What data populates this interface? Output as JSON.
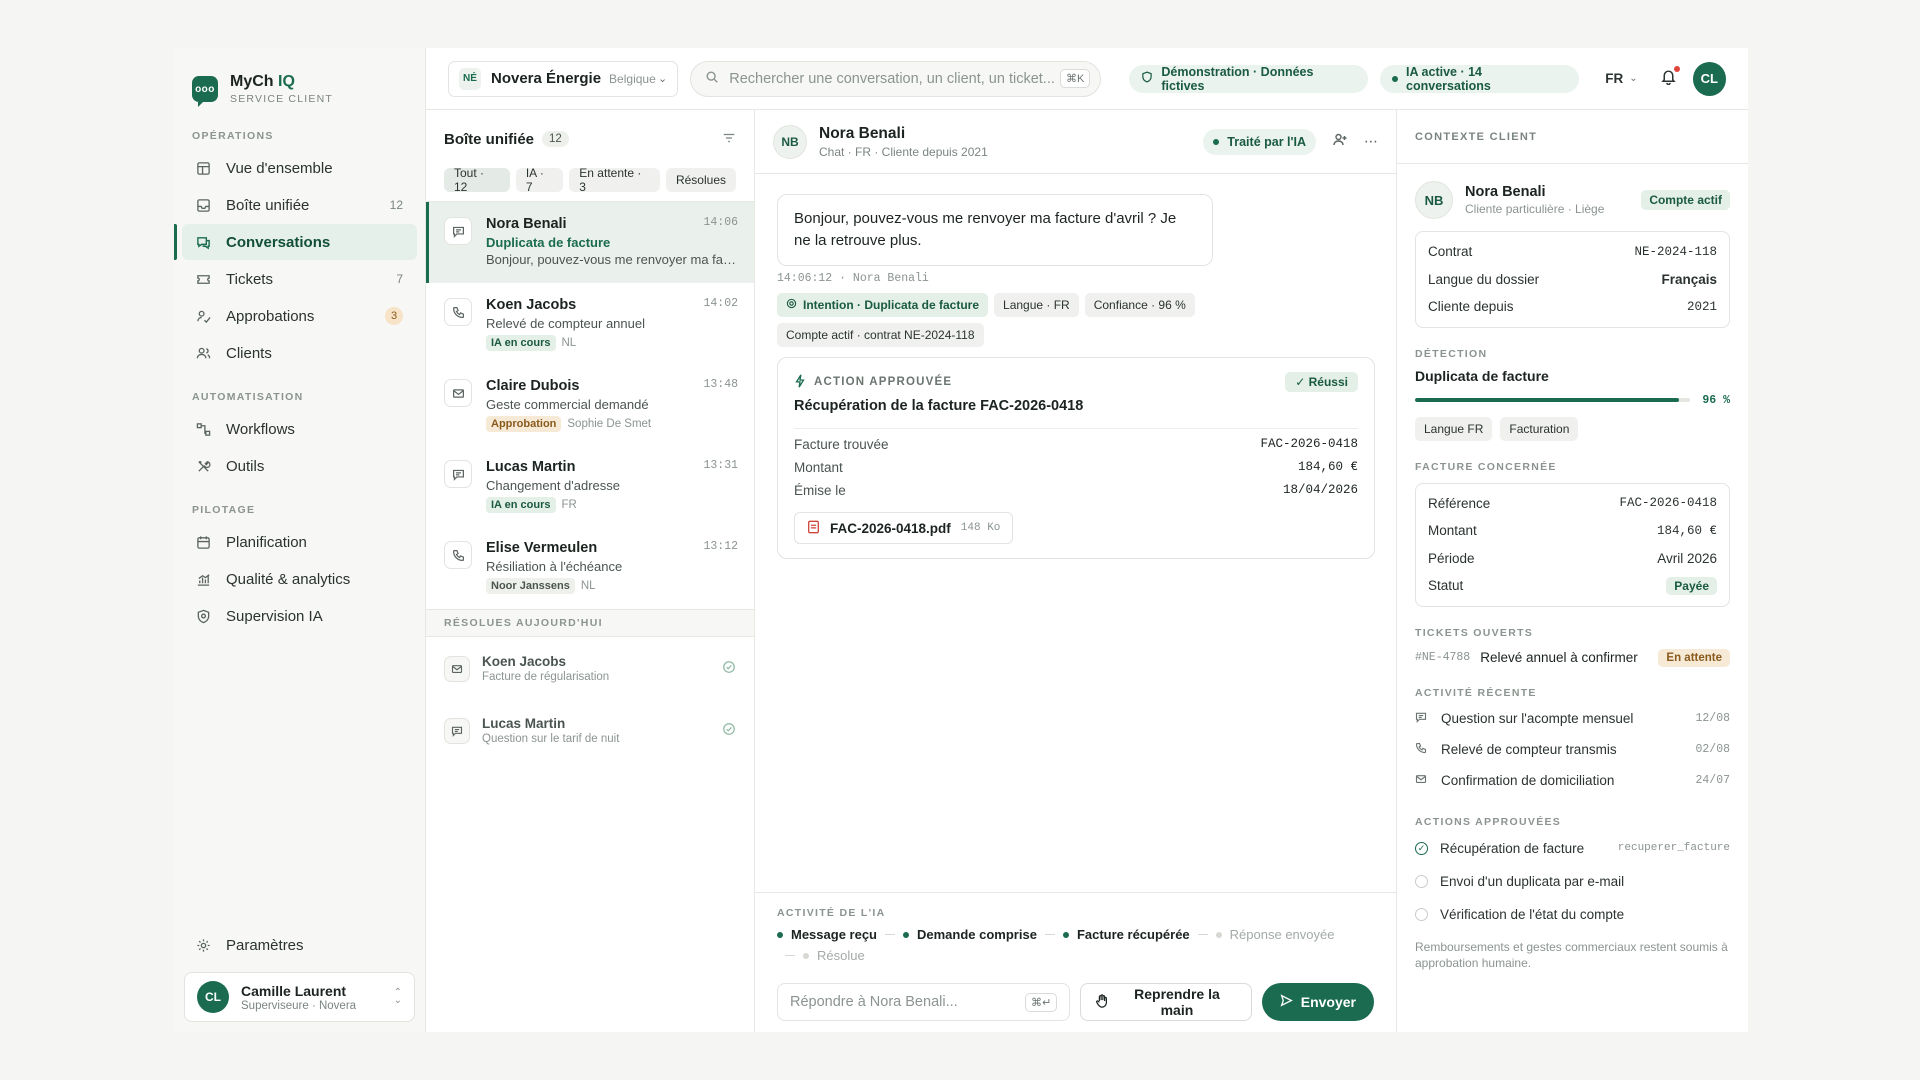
{
  "brand": {
    "name": "MyCh",
    "name_accent": "IQ",
    "subtitle": "SERVICE CLIENT",
    "logo_glyph": "ooo"
  },
  "sidebar": {
    "sections": [
      {
        "title": "OPÉRATIONS",
        "items": [
          {
            "label": "Vue d'ensemble",
            "icon": "layout-icon",
            "count": ""
          },
          {
            "label": "Boîte unifiée",
            "icon": "inbox-icon",
            "count": "12"
          },
          {
            "label": "Conversations",
            "icon": "chat-icon",
            "count": "",
            "active": true
          },
          {
            "label": "Tickets",
            "icon": "ticket-icon",
            "count": "7"
          },
          {
            "label": "Approbations",
            "icon": "signature-icon",
            "count": "3"
          },
          {
            "label": "Clients",
            "icon": "users-icon",
            "count": ""
          }
        ]
      },
      {
        "title": "AUTOMATISATION",
        "items": [
          {
            "label": "Workflows",
            "icon": "workflow-icon"
          },
          {
            "label": "Outils",
            "icon": "tools-icon"
          }
        ]
      },
      {
        "title": "PILOTAGE",
        "items": [
          {
            "label": "Planification",
            "icon": "calendar-icon"
          },
          {
            "label": "Qualité & analytics",
            "icon": "analytics-icon"
          },
          {
            "label": "Supervision IA",
            "icon": "shield-icon"
          }
        ]
      }
    ],
    "settings_label": "Paramètres",
    "user": {
      "initials": "CL",
      "name": "Camille Laurent",
      "role": "Superviseure · Novera"
    }
  },
  "topbar": {
    "org_badge": "NÉ",
    "org_name": "Novera Énergie",
    "org_country": "Belgique",
    "search_placeholder": "Rechercher une conversation, un client, un ticket...",
    "search_shortcut": "⌘K",
    "demo_pill": "Démonstration · Données fictives",
    "ai_pill": "IA active · 14 conversations",
    "lang": "FR",
    "user_initials": "CL"
  },
  "inbox": {
    "title": "Boîte unifiée",
    "count": "12",
    "filters": [
      "Tout · 12",
      "IA · 7",
      "En attente · 3",
      "Résolues"
    ],
    "conversations": [
      {
        "name": "Nora Benali",
        "time": "14:06",
        "subject": "Duplicata de facture",
        "preview": "Bonjour, pouvez-vous me renvoyer ma facture d'avril ? Je ne la retrouve plus.",
        "channel": "chat"
      },
      {
        "name": "Koen Jacobs",
        "time": "14:02",
        "subject": "Relevé de compteur annuel",
        "tag": "IA en cours",
        "meta": "NL",
        "channel": "phone"
      },
      {
        "name": "Claire Dubois",
        "time": "13:48",
        "subject": "Geste commercial demandé",
        "tag": "Approbation",
        "meta": "Sophie De Smet",
        "channel": "mail"
      },
      {
        "name": "Lucas Martin",
        "time": "13:31",
        "subject": "Changement d'adresse",
        "tag": "IA en cours",
        "meta": "FR",
        "channel": "chat"
      },
      {
        "name": "Elise Vermeulen",
        "time": "13:12",
        "subject": "Résiliation à l'échéance",
        "tag": "Noor Janssens",
        "meta": "NL",
        "channel": "phone"
      }
    ],
    "resolved_title": "RÉSOLUES AUJOURD'HUI",
    "resolved": [
      {
        "name": "Koen Jacobs",
        "subject": "Facture de régularisation"
      },
      {
        "name": "Lucas Martin",
        "subject": "Question sur le tarif de nuit"
      }
    ]
  },
  "conversation": {
    "initials": "NB",
    "name": "Nora Benali",
    "meta": "Chat · FR · Cliente depuis 2021",
    "ai_badge": "Traité par l'IA",
    "message": "Bonjour, pouvez-vous me renvoyer ma facture d'avril ? Je ne la retrouve plus.",
    "message_meta": "14:06:12 · Nora Benali",
    "chips": [
      "Intention · Duplicata de facture",
      "Langue · FR",
      "Confiance · 96 %",
      "Compte actif · contrat NE-2024-118"
    ],
    "action": {
      "label": "ACTION APPROUVÉE",
      "status": "Réussi",
      "title": "Récupération de la facture FAC-2026-0418",
      "rows": [
        {
          "k": "Facture trouvée",
          "v": "FAC-2026-0418"
        },
        {
          "k": "Montant",
          "v": "184,60 €"
        },
        {
          "k": "Émise le",
          "v": "18/04/2026"
        }
      ],
      "file_name": "FAC-2026-0418.pdf",
      "file_size": "148 Ko"
    },
    "activity_label": "ACTIVITÉ DE L'IA",
    "steps": [
      {
        "label": "Message reçu",
        "done": true
      },
      {
        "label": "Demande comprise",
        "done": true
      },
      {
        "label": "Facture récupérée",
        "done": true
      },
      {
        "label": "Réponse envoyée",
        "done": false
      },
      {
        "label": "Résolue",
        "done": false
      }
    ],
    "reply_placeholder": "Répondre à Nora Benali...",
    "reply_shortcut": "⌘↵",
    "takeover_label": "Reprendre la main",
    "send_label": "Envoyer"
  },
  "context": {
    "title": "CONTEXTE CLIENT",
    "client_initials": "NB",
    "client_name": "Nora Benali",
    "client_sub": "Cliente particulière · Liège",
    "account_badge": "Compte actif",
    "info": [
      {
        "k": "Contrat",
        "v": "NE-2024-118"
      },
      {
        "k": "Langue du dossier",
        "v": "Français"
      },
      {
        "k": "Cliente depuis",
        "v": "2021"
      }
    ],
    "detection_title": "DÉTECTION",
    "detection_value": "Duplicata de facture",
    "detection_confidence": 0.96,
    "detection_pct": "96 %",
    "detection_tags": [
      "Langue FR",
      "Facturation"
    ],
    "invoice_title": "FACTURE CONCERNÉE",
    "invoice": [
      {
        "k": "Référence",
        "v": "FAC-2026-0418"
      },
      {
        "k": "Montant",
        "v": "184,60 €"
      },
      {
        "k": "Période",
        "v": "Avril 2026"
      },
      {
        "k": "Statut",
        "v": "Payée"
      }
    ],
    "tickets_title": "TICKETS OUVERTS",
    "ticket": {
      "id": "#NE-4788",
      "label": "Relevé annuel à confirmer",
      "status": "En attente"
    },
    "activity_title": "ACTIVITÉ RÉCENTE",
    "activity": [
      {
        "label": "Question sur l'acompte mensuel",
        "date": "12/08",
        "icon": "chat-icon"
      },
      {
        "label": "Relevé de compteur transmis",
        "date": "02/08",
        "icon": "phone-icon"
      },
      {
        "label": "Confirmation de domiciliation",
        "date": "24/07",
        "icon": "mail-icon"
      }
    ],
    "approved_title": "ACTIONS APPROUVÉES",
    "approved": [
      {
        "label": "Récupération de facture",
        "code": "recuperer_facture",
        "done": true
      },
      {
        "label": "Envoi d'un duplicata par e-mail",
        "code": "",
        "done": false
      },
      {
        "label": "Vérification de l'état du compte",
        "code": "",
        "done": false
      }
    ],
    "note": "Remboursements et gestes commerciaux restent soumis à approbation humaine."
  },
  "colors": {
    "accent": "#1a6b4f",
    "accent_soft": "#eaf3ee",
    "amber": "#8a5a1c",
    "alert": "#e0443a"
  }
}
